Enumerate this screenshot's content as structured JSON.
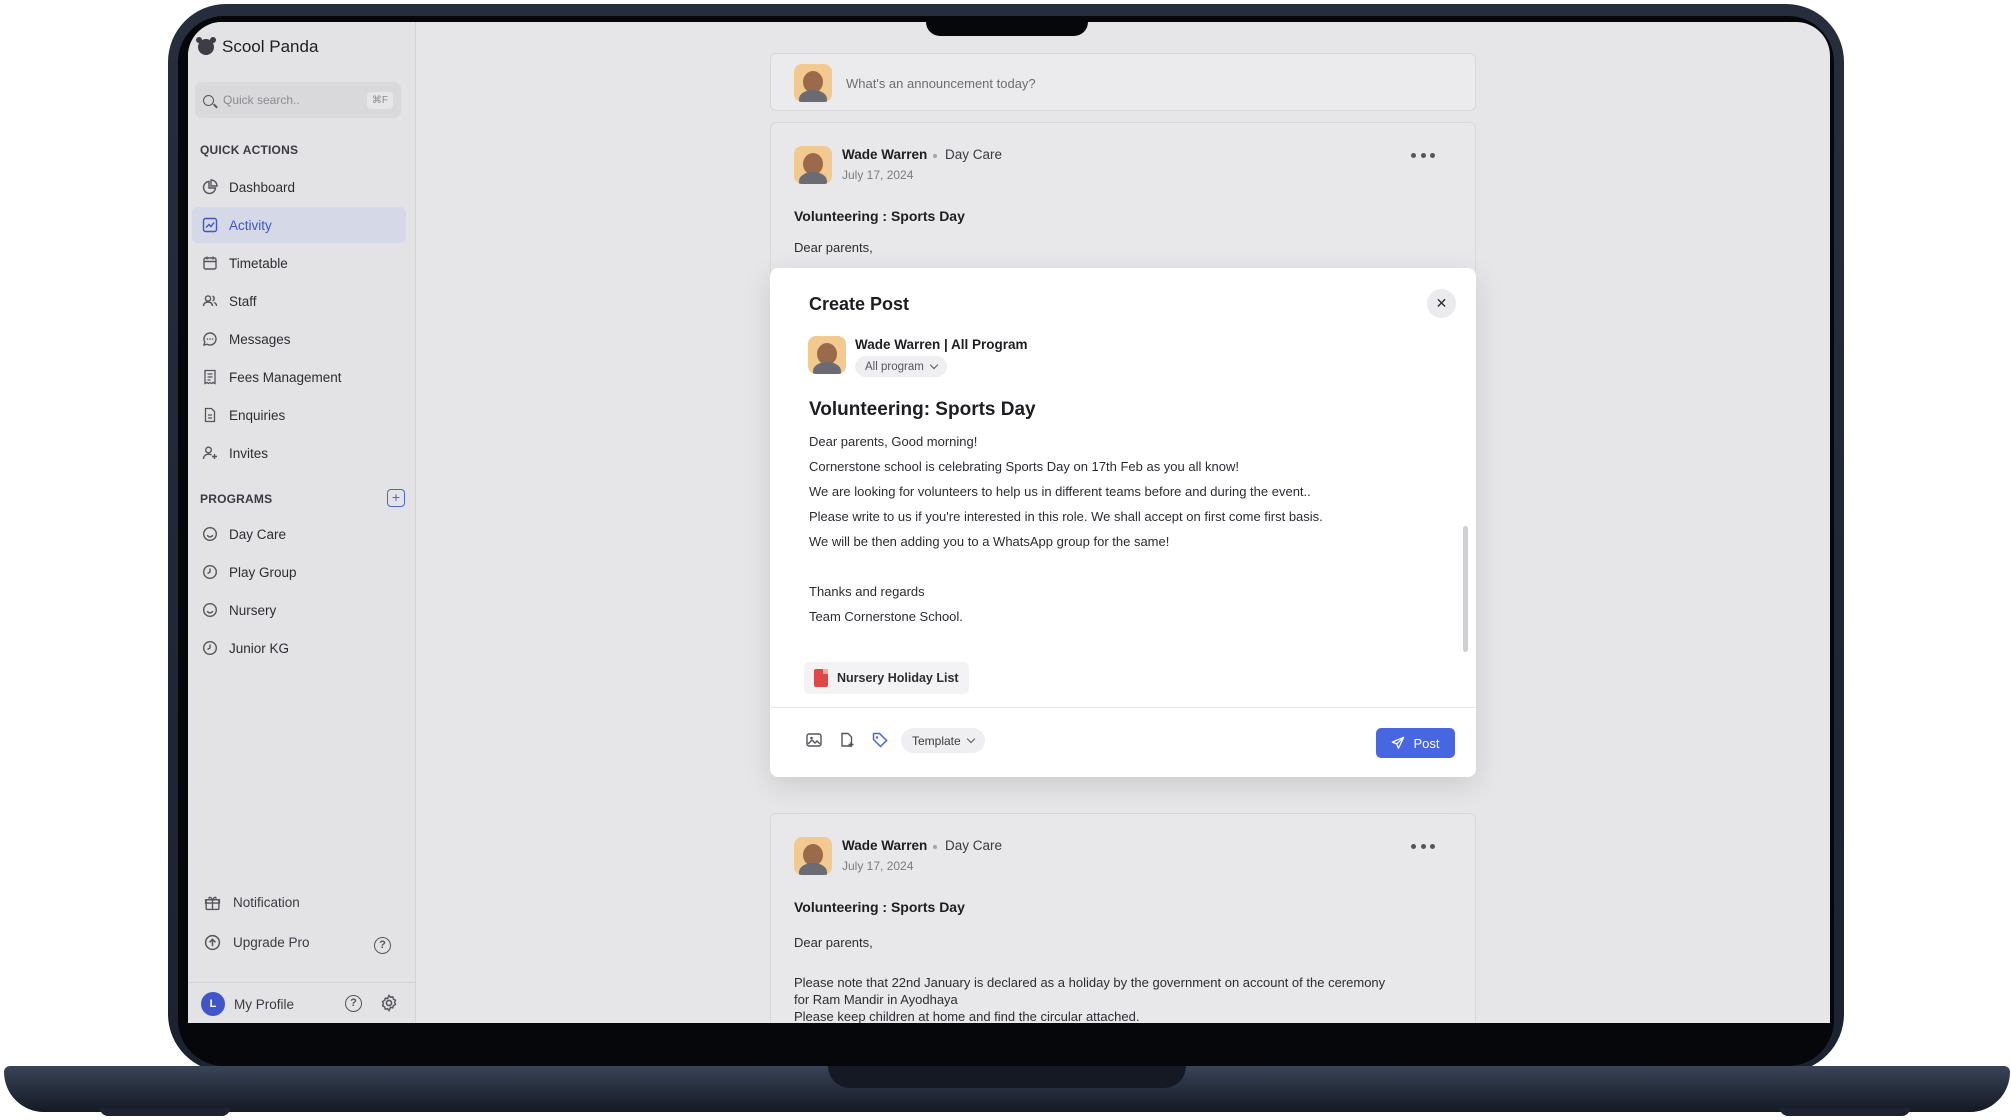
{
  "app": {
    "name": "Scool Panda"
  },
  "search": {
    "placeholder": "Quick search..",
    "shortcut": "⌘F"
  },
  "sidebar": {
    "quick_actions_label": "QUICK ACTIONS",
    "items": [
      {
        "label": "Dashboard",
        "icon": "pie-chart-icon"
      },
      {
        "label": "Activity",
        "icon": "activity-chart-icon",
        "active": true
      },
      {
        "label": "Timetable",
        "icon": "calendar-icon"
      },
      {
        "label": "Staff",
        "icon": "users-icon"
      },
      {
        "label": "Messages",
        "icon": "message-icon"
      },
      {
        "label": "Fees Management",
        "icon": "receipt-icon"
      },
      {
        "label": "Enquiries",
        "icon": "document-icon"
      },
      {
        "label": "Invites",
        "icon": "user-plus-icon"
      }
    ],
    "programs_label": "PROGRAMS",
    "programs": [
      {
        "label": "Day Care",
        "icon": "smile-icon"
      },
      {
        "label": "Play Group",
        "icon": "clock-icon"
      },
      {
        "label": "Nursery",
        "icon": "smile-icon"
      },
      {
        "label": "Junior KG",
        "icon": "clock-icon"
      }
    ],
    "notification_label": "Notification",
    "upgrade_label": "Upgrade Pro",
    "profile": {
      "initial": "L",
      "label": "My Profile"
    }
  },
  "composer": {
    "placeholder": "What's an announcement today?"
  },
  "posts": [
    {
      "author": "Wade Warren",
      "program": "Day Care",
      "date": "July 17, 2024",
      "title": "Volunteering : Sports Day",
      "lines": [
        "Dear parents,"
      ]
    },
    {
      "author": "Wade Warren",
      "program": "Day Care",
      "date": "July 17, 2024",
      "title": "Volunteering : Sports Day",
      "lines": [
        "Dear parents,",
        "Please note that 22nd January is declared as a holiday by the government on account of the ceremony",
        "for Ram Mandir in Ayodhaya",
        "Please keep children at home and find the circular attached."
      ]
    }
  ],
  "modal": {
    "title": "Create Post",
    "close_label": "✕",
    "author": "Wade Warren | All Program",
    "program_select": "All program",
    "post_title": "Volunteering: Sports Day",
    "lines": [
      "Dear parents, Good morning!",
      "Cornerstone school is celebrating Sports Day on 17th Feb as you all know!",
      "We are looking for volunteers to help us in different teams before and during the event..",
      "Please write to us if you're interested in this role. We shall accept on first come first basis.",
      "We will be then adding you to a WhatsApp group for the same!",
      "Thanks and regards",
      "Team Cornerstone School."
    ],
    "attachment": "Nursery Holiday List",
    "template_label": "Template",
    "post_label": "Post"
  },
  "colors": {
    "accent": "#4767E0",
    "active_bg": "#D5D8E6",
    "pdf": "#E04848"
  }
}
